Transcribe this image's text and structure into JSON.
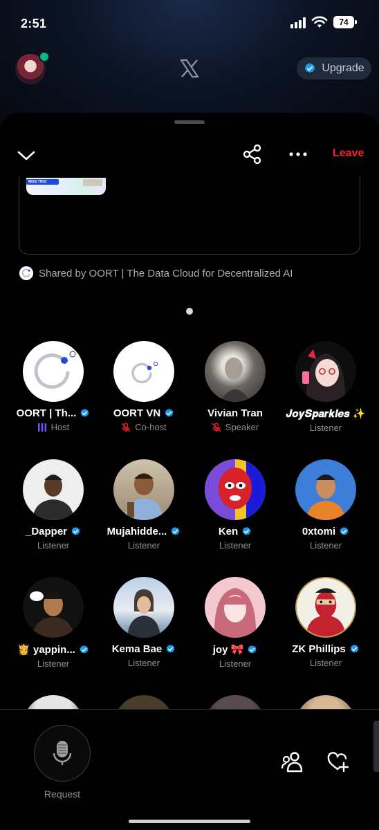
{
  "status": {
    "time": "2:51",
    "battery": "74"
  },
  "header": {
    "upgrade_label": "Upgrade"
  },
  "sheet": {
    "leave_label": "Leave",
    "shared_by": "Shared by OORT | The Data Cloud for Decentralized AI",
    "thumb_tag_text": "MISS THIS!"
  },
  "speakers": [
    {
      "name": "OORT | Th...",
      "role": "Host",
      "verified": true,
      "role_icon": "sound-bars-icon"
    },
    {
      "name": "OORT VN",
      "role": "Co-host",
      "verified": true,
      "role_icon": "mic-muted-icon"
    },
    {
      "name": "Vivian Tran",
      "role": "Speaker",
      "verified": false,
      "role_icon": "mic-muted-icon"
    },
    {
      "name": "𝑱𝒐𝒚𝑺𝒑𝒂𝒓𝒌𝒍𝒆𝒔 ✨",
      "role": "Listener",
      "verified": false
    },
    {
      "name": "_Dapper",
      "role": "Listener",
      "verified": true
    },
    {
      "name": "Mujahidde...",
      "role": "Listener",
      "verified": true
    },
    {
      "name": "Ken",
      "role": "Listener",
      "verified": true
    },
    {
      "name": "0xtomi",
      "role": "Listener",
      "verified": true
    },
    {
      "name": "👸 yappin...",
      "role": "Listener",
      "verified": true
    },
    {
      "name": "Kema Bae",
      "role": "Listener",
      "verified": true
    },
    {
      "name": "joy 🎀",
      "role": "Listener",
      "verified": true
    },
    {
      "name": "ZK Phillips",
      "role": "Listener",
      "verified": true
    }
  ],
  "bottom": {
    "request_label": "Request"
  },
  "colors": {
    "leave": "#f4212e",
    "verified": "#1d9bf0",
    "online": "#00ba7c",
    "oort_blue": "#2946d8"
  }
}
